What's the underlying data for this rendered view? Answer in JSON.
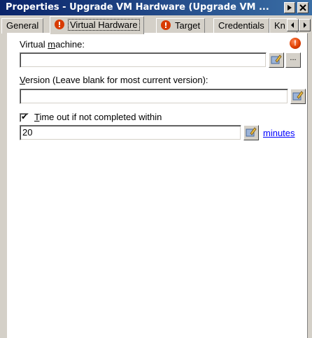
{
  "window": {
    "title": "Properties - Upgrade VM Hardware (Upgrade VM ..."
  },
  "tabs": [
    {
      "label": "General",
      "warning": false
    },
    {
      "label": "Virtual Hardware",
      "warning": true,
      "active": true
    },
    {
      "label": "Target",
      "warning": true
    },
    {
      "label": "Credentials",
      "warning": false
    },
    {
      "label": "Kn",
      "warning": false
    }
  ],
  "form": {
    "vm_label_pre": "Virtual ",
    "vm_label_accel": "m",
    "vm_label_post": "achine:",
    "vm_value": "",
    "vm_browse_label": "...",
    "version_label_accel": "V",
    "version_label_post": "ersion (Leave blank for most current version):",
    "version_value": "",
    "timeout_checked": true,
    "timeout_check_mark": "✔",
    "timeout_label_accel": "T",
    "timeout_label_post": "ime out if not completed within",
    "timeout_value": "20",
    "timeout_unit_link": "minutes",
    "error_mark": "!"
  },
  "colors": {
    "title_start": "#0a246a",
    "title_end": "#3a6ea5",
    "error": "#e04000",
    "link": "#0000ff"
  },
  "icons": {
    "picker": "picker-icon",
    "error": "error-icon",
    "close": "close-icon",
    "pin": "pin-icon"
  }
}
